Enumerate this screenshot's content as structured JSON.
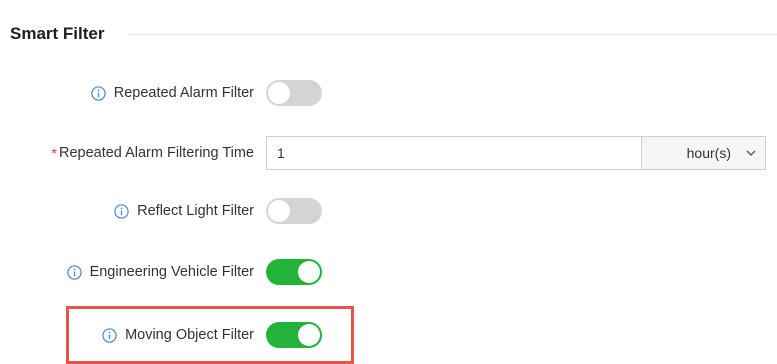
{
  "section": {
    "title": "Smart Filter"
  },
  "rows": {
    "repeated_alarm_filter": {
      "label": "Repeated Alarm Filter",
      "enabled": false
    },
    "filtering_time": {
      "required_mark": "*",
      "label": "Repeated Alarm Filtering Time",
      "value": "1",
      "unit": "hour(s)"
    },
    "reflect_light_filter": {
      "label": "Reflect Light Filter",
      "enabled": false
    },
    "engineering_vehicle_filter": {
      "label": "Engineering Vehicle Filter",
      "enabled": true
    },
    "moving_object_filter": {
      "label": "Moving Object Filter",
      "enabled": true
    }
  },
  "colors": {
    "toggle_on": "#22b33a",
    "toggle_off": "#d4d4d4",
    "info_icon": "#4a86d8",
    "highlight": "#e8534e",
    "required": "#e53935"
  },
  "icons": {
    "info": "info-circle-icon",
    "dropdown": "chevron-down-icon"
  }
}
